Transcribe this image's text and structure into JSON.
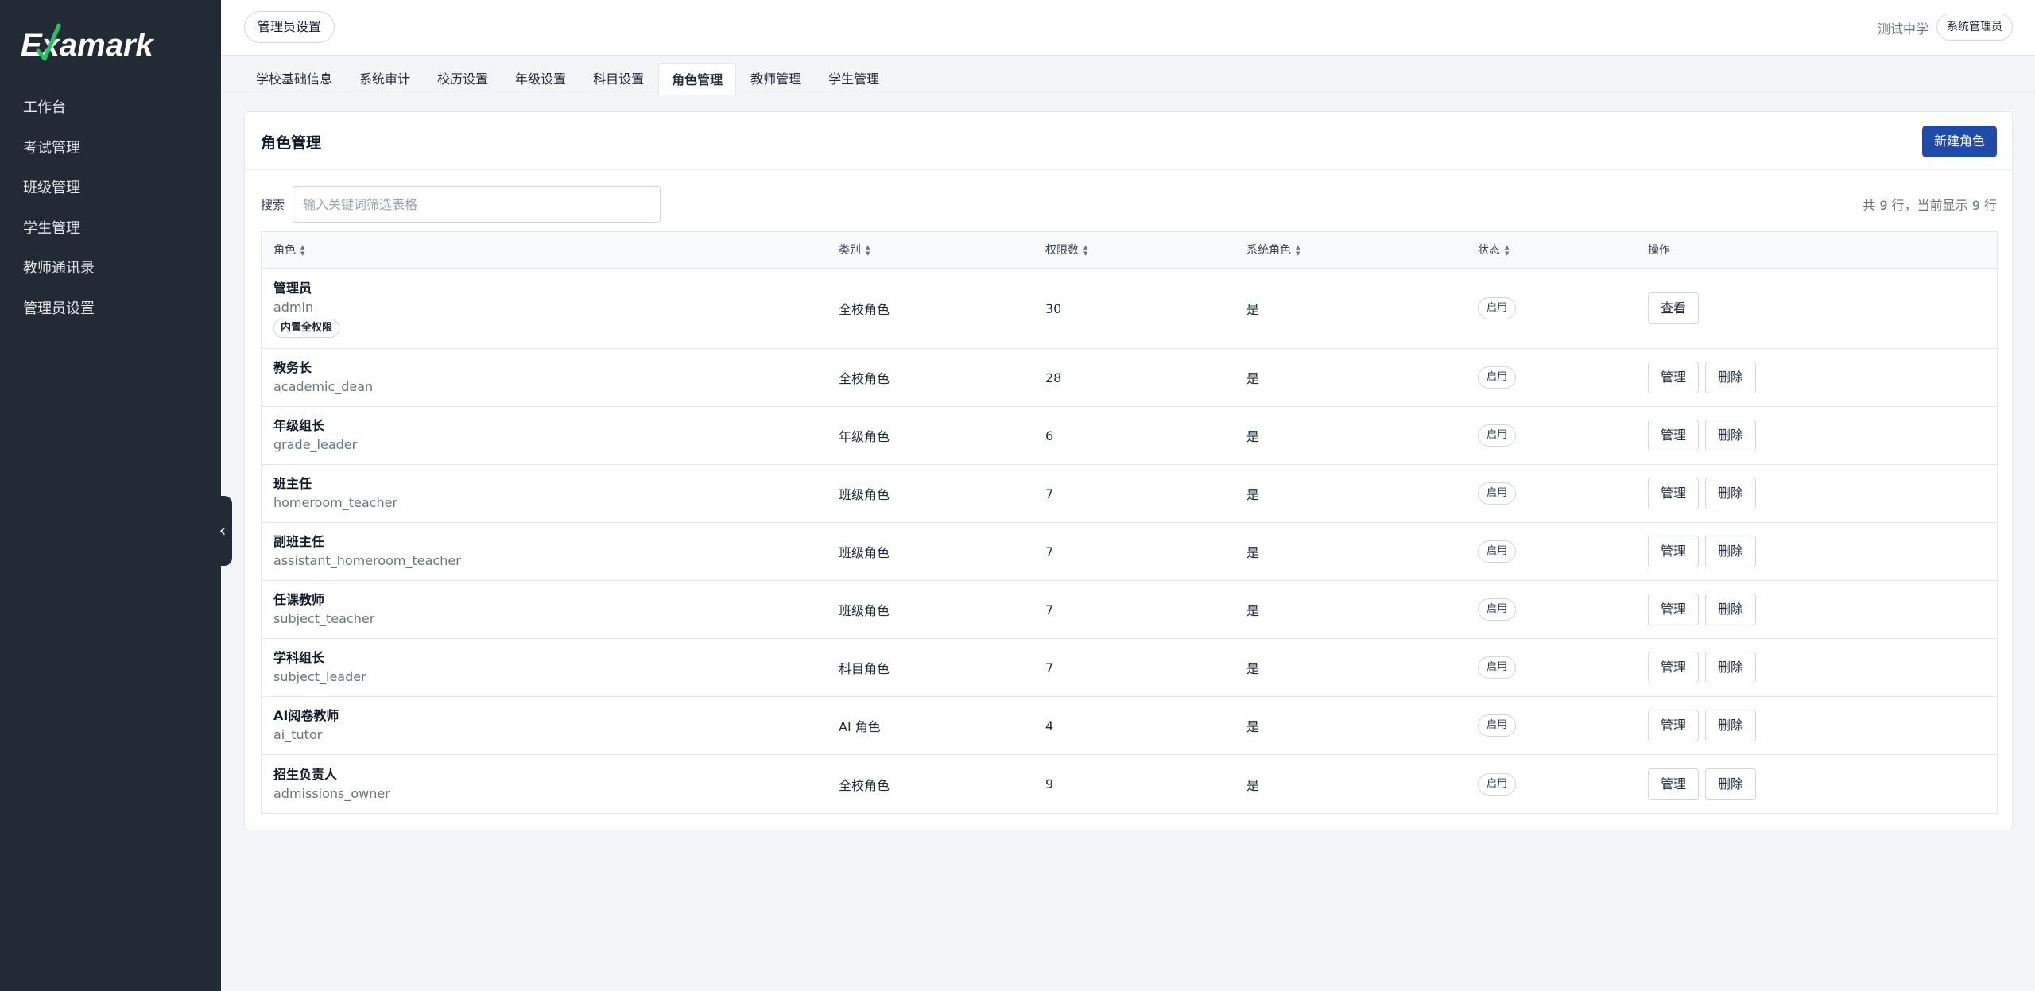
{
  "brand": {
    "logo_text": "Examark",
    "logo_check_color": "#22c55e"
  },
  "sidebar": {
    "items": [
      {
        "label": "工作台"
      },
      {
        "label": "考试管理"
      },
      {
        "label": "班级管理"
      },
      {
        "label": "学生管理"
      },
      {
        "label": "教师通讯录"
      },
      {
        "label": "管理员设置"
      }
    ],
    "collapse_glyph": "‹"
  },
  "header": {
    "page_title": "管理员设置",
    "school": "测试中学",
    "user_role": "系统管理员"
  },
  "tabs": [
    {
      "label": "学校基础信息"
    },
    {
      "label": "系统审计"
    },
    {
      "label": "校历设置"
    },
    {
      "label": "年级设置"
    },
    {
      "label": "科目设置"
    },
    {
      "label": "角色管理",
      "active": true
    },
    {
      "label": "教师管理"
    },
    {
      "label": "学生管理"
    }
  ],
  "card": {
    "title": "角色管理",
    "new_button": "新建角色",
    "search_label": "搜索",
    "search_placeholder": "输入关键词筛选表格",
    "search_value": "",
    "row_count": "共 9 行，当前显示 9 行"
  },
  "table": {
    "columns": [
      {
        "label": "角色",
        "sortable": true
      },
      {
        "label": "类别",
        "sortable": true
      },
      {
        "label": "权限数",
        "sortable": true
      },
      {
        "label": "系统角色",
        "sortable": true
      },
      {
        "label": "状态",
        "sortable": true
      },
      {
        "label": "操作",
        "sortable": false
      }
    ],
    "rows": [
      {
        "name": "管理员",
        "code": "admin",
        "badge": "内置全权限",
        "category": "全校角色",
        "perms": "30",
        "system": "是",
        "status": "启用",
        "actions": [
          "查看"
        ]
      },
      {
        "name": "教务长",
        "code": "academic_dean",
        "category": "全校角色",
        "perms": "28",
        "system": "是",
        "status": "启用",
        "actions": [
          "管理",
          "删除"
        ]
      },
      {
        "name": "年级组长",
        "code": "grade_leader",
        "category": "年级角色",
        "perms": "6",
        "system": "是",
        "status": "启用",
        "actions": [
          "管理",
          "删除"
        ]
      },
      {
        "name": "班主任",
        "code": "homeroom_teacher",
        "category": "班级角色",
        "perms": "7",
        "system": "是",
        "status": "启用",
        "actions": [
          "管理",
          "删除"
        ]
      },
      {
        "name": "副班主任",
        "code": "assistant_homeroom_teacher",
        "category": "班级角色",
        "perms": "7",
        "system": "是",
        "status": "启用",
        "actions": [
          "管理",
          "删除"
        ]
      },
      {
        "name": "任课教师",
        "code": "subject_teacher",
        "category": "班级角色",
        "perms": "7",
        "system": "是",
        "status": "启用",
        "actions": [
          "管理",
          "删除"
        ]
      },
      {
        "name": "学科组长",
        "code": "subject_leader",
        "category": "科目角色",
        "perms": "7",
        "system": "是",
        "status": "启用",
        "actions": [
          "管理",
          "删除"
        ]
      },
      {
        "name": "AI阅卷教师",
        "code": "ai_tutor",
        "category": "AI 角色",
        "perms": "4",
        "system": "是",
        "status": "启用",
        "actions": [
          "管理",
          "删除"
        ]
      },
      {
        "name": "招生负责人",
        "code": "admissions_owner",
        "category": "全校角色",
        "perms": "9",
        "system": "是",
        "status": "启用",
        "actions": [
          "管理",
          "删除"
        ]
      }
    ]
  }
}
